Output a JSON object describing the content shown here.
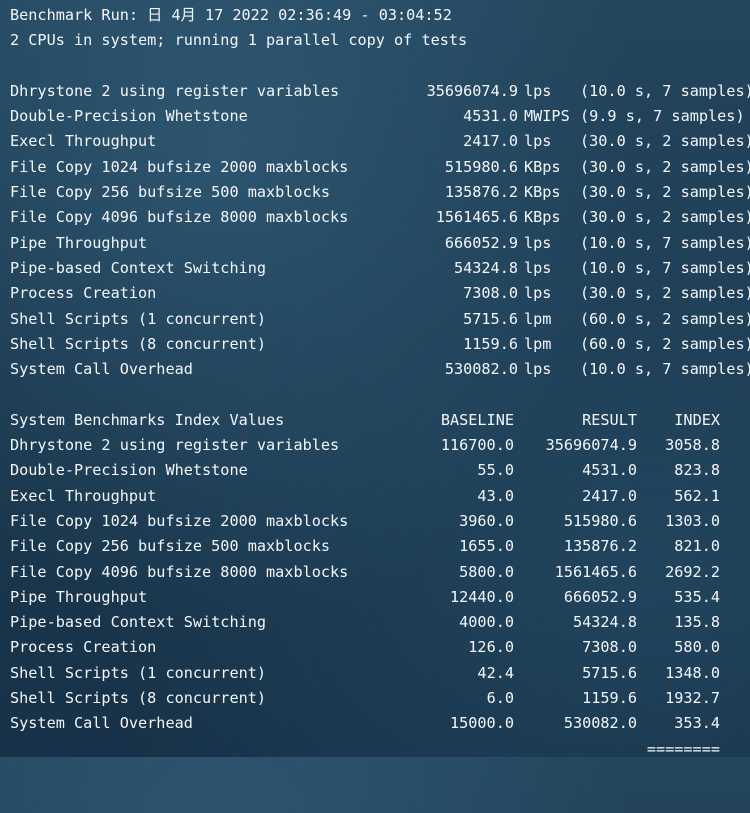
{
  "header": {
    "run_line": "Benchmark Run: 日 4月 17 2022 02:36:49 - 03:04:52",
    "cpu_line": "2 CPUs in system; running 1 parallel copy of tests"
  },
  "results": [
    {
      "name": "Dhrystone 2 using register variables",
      "value": "35696074.9",
      "unit": "lps",
      "info": "(10.0 s, 7 samples)"
    },
    {
      "name": "Double-Precision Whetstone",
      "value": "4531.0",
      "unit": "MWIPS",
      "info": "(9.9 s, 7 samples)"
    },
    {
      "name": "Execl Throughput",
      "value": "2417.0",
      "unit": "lps",
      "info": "(30.0 s, 2 samples)"
    },
    {
      "name": "File Copy 1024 bufsize 2000 maxblocks",
      "value": "515980.6",
      "unit": "KBps",
      "info": "(30.0 s, 2 samples)"
    },
    {
      "name": "File Copy 256 bufsize 500 maxblocks",
      "value": "135876.2",
      "unit": "KBps",
      "info": "(30.0 s, 2 samples)"
    },
    {
      "name": "File Copy 4096 bufsize 8000 maxblocks",
      "value": "1561465.6",
      "unit": "KBps",
      "info": "(30.0 s, 2 samples)"
    },
    {
      "name": "Pipe Throughput",
      "value": "666052.9",
      "unit": "lps",
      "info": "(10.0 s, 7 samples)"
    },
    {
      "name": "Pipe-based Context Switching",
      "value": "54324.8",
      "unit": "lps",
      "info": "(10.0 s, 7 samples)"
    },
    {
      "name": "Process Creation",
      "value": "7308.0",
      "unit": "lps",
      "info": "(30.0 s, 2 samples)"
    },
    {
      "name": "Shell Scripts (1 concurrent)",
      "value": "5715.6",
      "unit": "lpm",
      "info": "(60.0 s, 2 samples)"
    },
    {
      "name": "Shell Scripts (8 concurrent)",
      "value": "1159.6",
      "unit": "lpm",
      "info": "(60.0 s, 2 samples)"
    },
    {
      "name": "System Call Overhead",
      "value": "530082.0",
      "unit": "lps",
      "info": "(10.0 s, 7 samples)"
    }
  ],
  "index_table": {
    "title": "System Benchmarks Index Values",
    "col_baseline": "BASELINE",
    "col_result": "RESULT",
    "col_index": "INDEX",
    "rows": [
      {
        "name": "Dhrystone 2 using register variables",
        "baseline": "116700.0",
        "result": "35696074.9",
        "index": "3058.8"
      },
      {
        "name": "Double-Precision Whetstone",
        "baseline": "55.0",
        "result": "4531.0",
        "index": "823.8"
      },
      {
        "name": "Execl Throughput",
        "baseline": "43.0",
        "result": "2417.0",
        "index": "562.1"
      },
      {
        "name": "File Copy 1024 bufsize 2000 maxblocks",
        "baseline": "3960.0",
        "result": "515980.6",
        "index": "1303.0"
      },
      {
        "name": "File Copy 256 bufsize 500 maxblocks",
        "baseline": "1655.0",
        "result": "135876.2",
        "index": "821.0"
      },
      {
        "name": "File Copy 4096 bufsize 8000 maxblocks",
        "baseline": "5800.0",
        "result": "1561465.6",
        "index": "2692.2"
      },
      {
        "name": "Pipe Throughput",
        "baseline": "12440.0",
        "result": "666052.9",
        "index": "535.4"
      },
      {
        "name": "Pipe-based Context Switching",
        "baseline": "4000.0",
        "result": "54324.8",
        "index": "135.8"
      },
      {
        "name": "Process Creation",
        "baseline": "126.0",
        "result": "7308.0",
        "index": "580.0"
      },
      {
        "name": "Shell Scripts (1 concurrent)",
        "baseline": "42.4",
        "result": "5715.6",
        "index": "1348.0"
      },
      {
        "name": "Shell Scripts (8 concurrent)",
        "baseline": "6.0",
        "result": "1159.6",
        "index": "1932.7"
      },
      {
        "name": "System Call Overhead",
        "baseline": "15000.0",
        "result": "530082.0",
        "index": "353.4"
      }
    ],
    "separator": "========"
  }
}
